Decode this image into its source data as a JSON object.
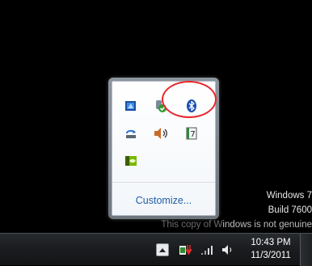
{
  "watermark": {
    "line1": "Windows 7",
    "line2": "Build 7600",
    "line3_dim": "This copy of W",
    "line3": "indows is not genuine"
  },
  "flyout": {
    "customize_label": "Customize...",
    "icons": [
      "windows-mobile-device-center-icon",
      "security-shield-icon",
      "bluetooth-icon",
      "safely-remove-hardware-icon",
      "volume-icon",
      "notebook-icon",
      "nvidia-icon"
    ]
  },
  "taskbar": {
    "time": "10:43 PM",
    "date": "11/3/2011",
    "tray_icons": [
      "show-hidden-icons-arrow",
      "power-plug-icon",
      "network-signal-icon",
      "volume-icon"
    ]
  },
  "annotation": {
    "color": "#e8262c"
  }
}
